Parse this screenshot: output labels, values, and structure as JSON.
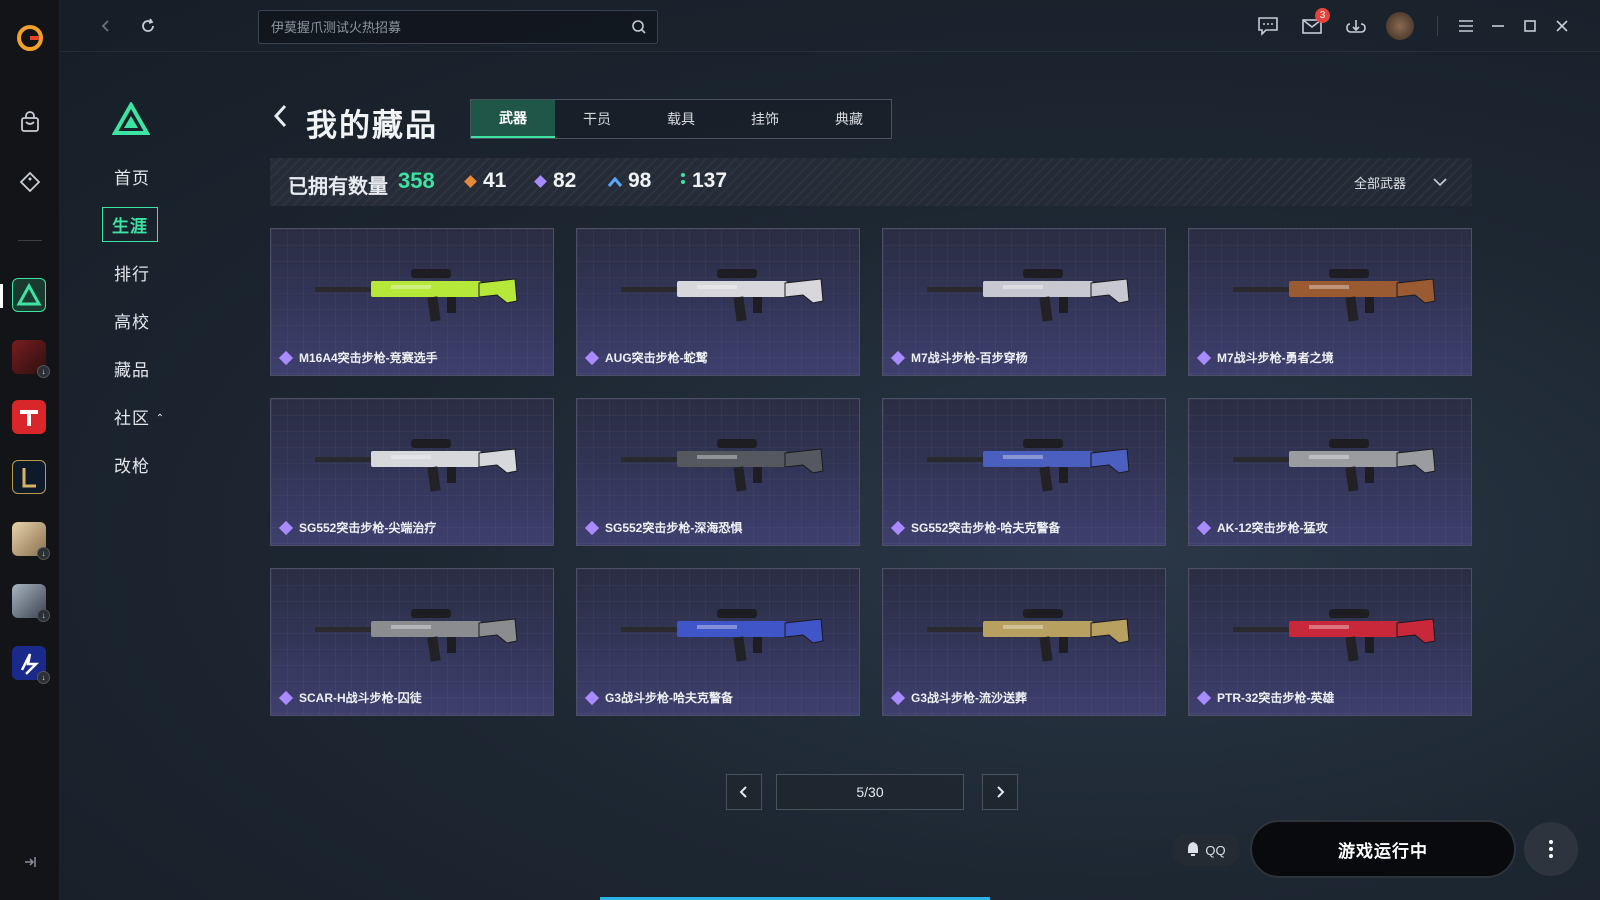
{
  "topbar": {
    "search_placeholder": "伊莫握爪测试火热招募",
    "mail_badge": "3"
  },
  "nav": {
    "items": [
      {
        "label": "首页"
      },
      {
        "label": "生涯",
        "active": true
      },
      {
        "label": "排行"
      },
      {
        "label": "高校"
      },
      {
        "label": "藏品"
      },
      {
        "label": "社区"
      },
      {
        "label": "改枪"
      }
    ]
  },
  "page": {
    "title": "我的藏品",
    "tabs": [
      "武器",
      "干员",
      "载具",
      "挂饰",
      "典藏"
    ],
    "active_tab": "武器"
  },
  "stats": {
    "owned_label": "已拥有数量",
    "owned_total": "358",
    "rarity_counts": [
      {
        "color": "#e8893a",
        "count": "41"
      },
      {
        "color": "#a98bff",
        "count": "82"
      },
      {
        "color": "#5aa8ff",
        "count": "98"
      },
      {
        "color": "#3ce3a2",
        "count": "137"
      }
    ],
    "filter_label": "全部武器"
  },
  "cards": [
    {
      "name": "M16A4突击步枪-竞赛选手",
      "color": "#b6e83a"
    },
    {
      "name": "AUG突击步枪-蛇鹫",
      "color": "#d8d8dc"
    },
    {
      "name": "M7战斗步枪-百步穿杨",
      "color": "#c8c8d0"
    },
    {
      "name": "M7战斗步枪-勇者之境",
      "color": "#9a5a32"
    },
    {
      "name": "SG552突击步枪-尖端治疗",
      "color": "#d6d8dc"
    },
    {
      "name": "SG552突击步枪-深海恐惧",
      "color": "#55585e"
    },
    {
      "name": "SG552突击步枪-哈夫克警备",
      "color": "#4a5fc0"
    },
    {
      "name": "AK-12突击步枪-猛攻",
      "color": "#9a9ca0"
    },
    {
      "name": "SCAR-H战斗步枪-囚徒",
      "color": "#8a8c90"
    },
    {
      "name": "G3战斗步枪-哈夫克警备",
      "color": "#3f55c8"
    },
    {
      "name": "G3战斗步枪-流沙送葬",
      "color": "#b8a060"
    },
    {
      "name": "PTR-32突击步枪-英雄",
      "color": "#c8283a"
    }
  ],
  "pagination": {
    "label": "5/30"
  },
  "footer": {
    "qq_label": "QQ",
    "launch_label": "游戏运行中"
  },
  "colors": {
    "accent": "#3ce3a2",
    "card_bg": "#34365a"
  }
}
